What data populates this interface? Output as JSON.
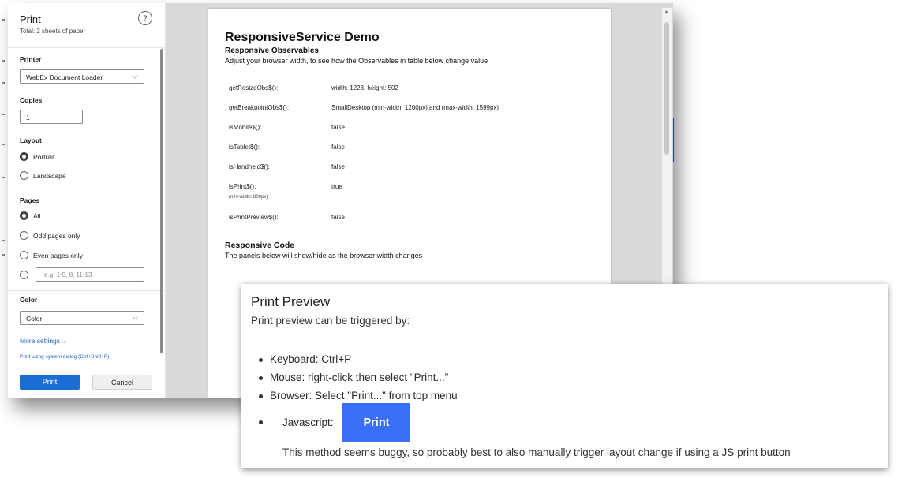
{
  "print_panel": {
    "title": "Print",
    "subtitle": "Total: 2 sheets of paper",
    "help": "?",
    "printer_label": "Printer",
    "printer_value": "WebEx Document Loader",
    "copies_label": "Copies",
    "copies_value": "1",
    "layout_label": "Layout",
    "layout_options": [
      "Portrait",
      "Landscape"
    ],
    "layout_selected": "Portrait",
    "pages_label": "Pages",
    "pages_options": [
      "All",
      "Odd pages only",
      "Even pages only"
    ],
    "pages_range_placeholder": "e.g. 1-5, 8, 11-13",
    "pages_selected": "All",
    "color_label": "Color",
    "color_value": "Color",
    "more_settings": "More settings",
    "system_dialog_link": "Print using system dialog (Ctrl+Shift+P)",
    "print_button": "Print",
    "cancel_button": "Cancel"
  },
  "preview": {
    "title": "ResponsiveService Demo",
    "subtitle": "Responsive Observables",
    "description": "Adjust your browser width, to see how the Observables in table below change value",
    "observables": [
      {
        "name": "getResizeObs$():",
        "value": "width: 1223, height: 502"
      },
      {
        "name": "getBreakpointObs$():",
        "value": "SmallDesktop (min-width: 1200px) and (max-width: 1599px)"
      },
      {
        "name": "isMobile$():",
        "value": "false"
      },
      {
        "name": "isTablet$():",
        "value": "false"
      },
      {
        "name": "isHandheld$():",
        "value": "false"
      },
      {
        "name": "isPrint$():",
        "value": "true",
        "note": "(min-width: 800px)"
      },
      {
        "name": "isPrintPreview$():",
        "value": "false"
      }
    ],
    "code_title": "Responsive Code",
    "code_description": "The panels below will show/hide as the browser width changes"
  },
  "overlay": {
    "title": "Print Preview",
    "subtitle": "Print preview can be triggered by:",
    "items": [
      "Keyboard: Ctrl+P",
      "Mouse: right-click then select \"Print...\"",
      "Browser: Select \"Print...\" from top menu"
    ],
    "js_label": "Javascript:",
    "js_button": "Print",
    "note": "This method seems buggy, so probably best to also manually trigger layout change if using a JS print button"
  },
  "colors": {
    "accent": "#1a6ed3",
    "js_button": "#3a6ff7",
    "link": "#1667c1"
  }
}
